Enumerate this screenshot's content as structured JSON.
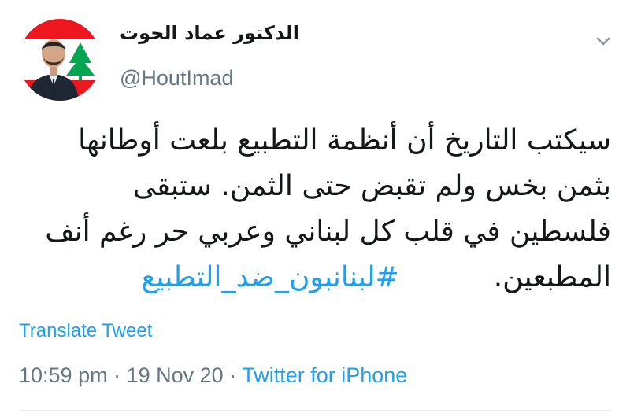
{
  "user": {
    "display_name": "الدكتور عماد الحوت",
    "handle": "@HoutImad",
    "avatar_icon": "profile-photo-with-lebanese-flag"
  },
  "tweet": {
    "lines": [
      "سيكتب التاريخ أن أنظمة التطبيع بلعت أوطانها",
      "بثمن بخس ولم تقبض حتى الثمن. ستبقى",
      "فلسطين في قلب كل لبناني وعربي حر رغم أنف"
    ],
    "last_line_text": "المطبعين.",
    "hashtag": "#لبنانبون_ضد_التطبيع"
  },
  "translate_label": "Translate Tweet",
  "meta": {
    "time": "10:59 pm",
    "separator": "·",
    "date": "19 Nov 20",
    "source": "Twitter for iPhone"
  },
  "menu_icon": "chevron-down-icon",
  "colors": {
    "link": "#1da1f2",
    "text": "#14171a",
    "secondary": "#657786",
    "divider": "#e1e8ed"
  }
}
